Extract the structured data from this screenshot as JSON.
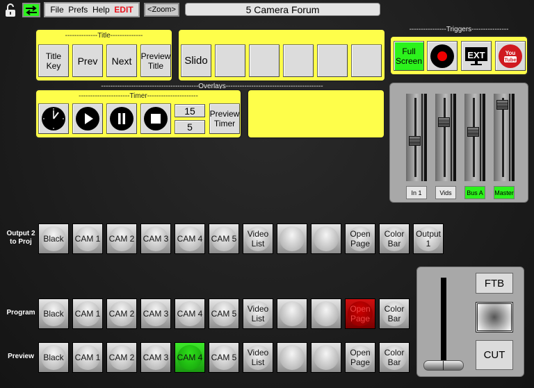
{
  "toolbar": {
    "lock_icon": "unlocked-padlock-icon",
    "swap_icon": "swap-arrows-icon",
    "menu": [
      "File",
      "Prefs",
      "Help"
    ],
    "edit_label": "EDIT",
    "zoom_label": "<Zoom>",
    "title": "5 Camera Forum",
    "colors": {
      "swap_bg": "#2cf21c",
      "edit": "#e8141e"
    }
  },
  "title_panel": {
    "header": "--------------Title--------------",
    "buttons": [
      {
        "label": "Title Key"
      },
      {
        "label": "Prev"
      },
      {
        "label": "Next"
      },
      {
        "label": "Preview Title"
      }
    ]
  },
  "slido_panel": {
    "buttons": [
      {
        "label": "Slido"
      },
      {
        "label": ""
      },
      {
        "label": ""
      },
      {
        "label": ""
      },
      {
        "label": ""
      },
      {
        "label": ""
      }
    ]
  },
  "overlays_header": "------------------------------------------Overlays------------------------------------------",
  "timer_panel": {
    "header": "----------------------Timer----------------------",
    "clock_icon": "clock-icon",
    "play_icon": "play-icon",
    "pause_icon": "pause-icon",
    "stop_icon": "stop-icon",
    "minutes": "15",
    "seconds": "5",
    "preview_label": "Preview Timer"
  },
  "triggers": {
    "header": "----------------Triggers----------------",
    "fullscreen_label": "Full Screen",
    "record_icon": "record-icon",
    "ext_label": "EXT",
    "youtube_label_1": "You",
    "youtube_label_2": "Tube",
    "colors": {
      "fullscreen": "#2cf21c"
    }
  },
  "mixer": {
    "channels": [
      {
        "label": "In 1",
        "level": 0.45,
        "active": false
      },
      {
        "label": "Vids",
        "level": 0.72,
        "active": false
      },
      {
        "label": "Bus A",
        "level": 0.58,
        "active": true
      },
      {
        "label": "Master",
        "level": 0.97,
        "active": true
      }
    ]
  },
  "rows": [
    {
      "label": "Output 2 to Proj",
      "buttons": [
        "Black",
        "CAM 1",
        "CAM 2",
        "CAM 3",
        "CAM 4",
        "CAM 5",
        "Video List",
        "",
        "",
        "Open Page",
        "Color Bar",
        "Output 1"
      ],
      "active": -1,
      "state": ""
    },
    {
      "label": "Program",
      "buttons": [
        "Black",
        "CAM 1",
        "CAM 2",
        "CAM 3",
        "CAM 4",
        "CAM 5",
        "Video List",
        "",
        "",
        "Open Page",
        "Color Bar"
      ],
      "active": 9,
      "state": "red"
    },
    {
      "label": "Preview",
      "buttons": [
        "Black",
        "CAM 1",
        "CAM 2",
        "CAM 3",
        "CAM 4",
        "CAM 5",
        "Video List",
        "",
        "",
        "Open Page",
        "Color Bar"
      ],
      "active": 4,
      "state": "green"
    }
  ],
  "transition": {
    "ftb_label": "FTB",
    "cut_label": "CUT",
    "tbar_position": 0.0,
    "transition_icon": "wipe-gradient-icon"
  }
}
